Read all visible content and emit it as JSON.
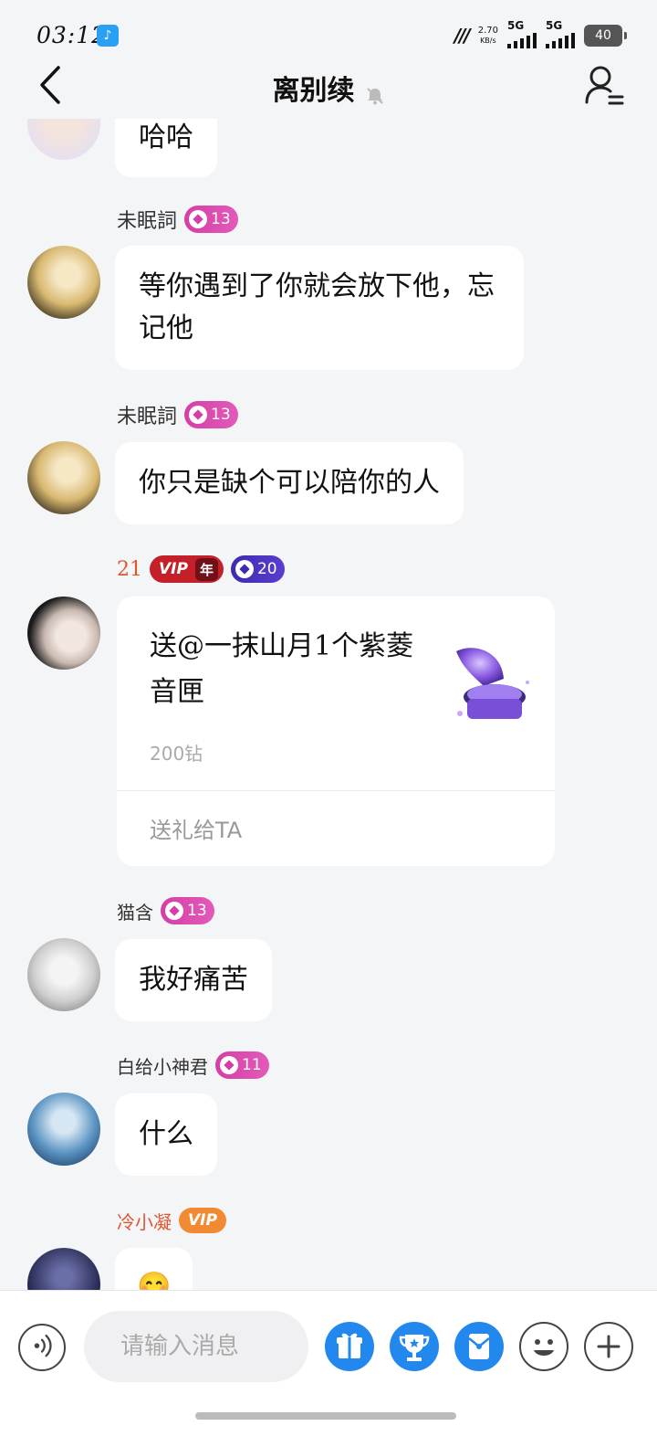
{
  "status_bar": {
    "time": "03:12",
    "net_speed": "2.70",
    "net_unit": "KB/s",
    "sim1": "5G",
    "sim2": "5G",
    "battery": "40"
  },
  "header": {
    "title": "离别续"
  },
  "messages": [
    {
      "text": "哈哈"
    },
    {
      "name": "未眠詞",
      "level": "13",
      "text": "等你遇到了你就会放下他，忘记他"
    },
    {
      "name": "未眠詞",
      "level": "13",
      "text": "你只是缺个可以陪你的人"
    },
    {
      "name": "21",
      "vip": "VIP",
      "vip_year": "年",
      "level": "20"
    },
    {
      "name": "猫含",
      "level": "13",
      "text": "我好痛苦"
    },
    {
      "name": "白给小神君",
      "level": "11",
      "text": "什么"
    },
    {
      "name": "冷小凝",
      "vip": "VIP",
      "text": "😊"
    }
  ],
  "gift": {
    "text": "送@一抹山月1个紫菱音匣",
    "price": "200钻",
    "send_label": "送礼给TA"
  },
  "input": {
    "placeholder": "请输入消息"
  },
  "colors": {
    "accent_blue": "#2288ee",
    "level_pink": "#d43fa5",
    "level_purple": "#3c2bb0",
    "vip_red": "#c4202a",
    "vip_orange": "#f28a34"
  }
}
